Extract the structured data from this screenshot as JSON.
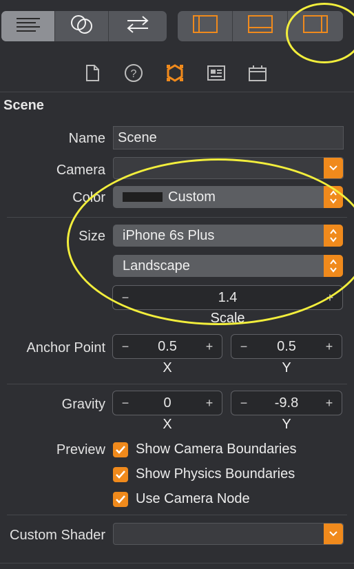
{
  "toolbar": {
    "left_segment": [
      {
        "icon": "lines-icon"
      },
      {
        "icon": "circles-icon"
      },
      {
        "icon": "arrows-icon"
      }
    ],
    "right_segment": [
      {
        "icon": "left-panel-icon"
      },
      {
        "icon": "bottom-panel-icon"
      },
      {
        "icon": "right-panel-icon"
      }
    ]
  },
  "inspector_tabs": [
    "file-icon",
    "help-icon",
    "attributes-icon",
    "identity-icon",
    "size-icon"
  ],
  "section": {
    "title": "Scene"
  },
  "fields": {
    "name_label": "Name",
    "name_value": "Scene",
    "camera_label": "Camera",
    "camera_value": "",
    "color_label": "Color",
    "color_value": "Custom",
    "color_swatch": "#1f1f1f",
    "size_label": "Size",
    "size_device": "iPhone 6s Plus",
    "size_orientation": "Landscape",
    "scale_value": "1.4",
    "scale_label": "Scale",
    "anchor_label": "Anchor Point",
    "anchor_x": "0.5",
    "anchor_y": "0.5",
    "x_label": "X",
    "y_label": "Y",
    "gravity_label": "Gravity",
    "gravity_x": "0",
    "gravity_y": "-9.8",
    "preview_label": "Preview",
    "show_camera_bounds": "Show Camera Boundaries",
    "show_physics_bounds": "Show Physics Boundaries",
    "use_camera_node": "Use Camera Node",
    "custom_shader_label": "Custom Shader",
    "custom_shader_value": ""
  },
  "stepper": {
    "minus": "−",
    "plus": "+"
  },
  "colors": {
    "accent": "#f08a1c",
    "annotation": "#f2ee3c"
  }
}
